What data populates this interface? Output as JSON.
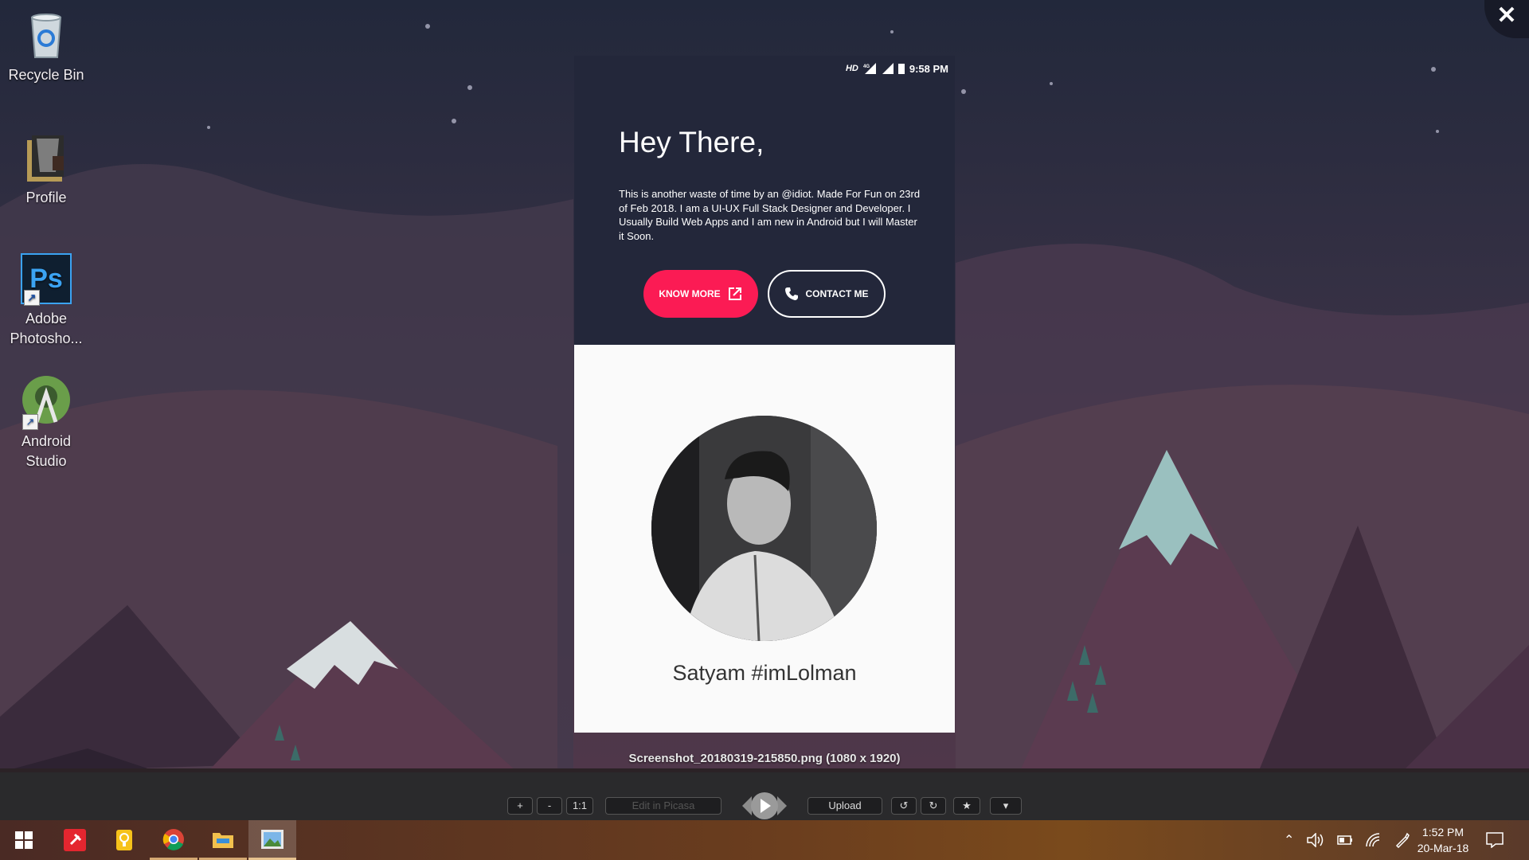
{
  "desktop": {
    "icons": [
      {
        "label": "Recycle Bin",
        "icon": "recycle-bin-icon"
      },
      {
        "label": "Profile",
        "icon": "folder-icon"
      },
      {
        "label": "Adobe\nPhotosho...",
        "icon_text": "Ps",
        "icon": "photoshop-icon"
      },
      {
        "label": "Android\nStudio",
        "icon": "android-studio-icon"
      }
    ]
  },
  "viewer": {
    "close_glyph": "✕",
    "filename": "Screenshot_20180319-215850.png (1080 x 1920)",
    "toolbar": {
      "zoom_in": "+",
      "zoom_out": "-",
      "actual_size": "1:1",
      "edit": "Edit in Picasa",
      "upload": "Upload",
      "rotate_left_glyph": "↺",
      "rotate_right_glyph": "↻",
      "star_glyph": "★",
      "more_glyph": "▾"
    }
  },
  "phone": {
    "status": {
      "hd": "HD",
      "network": "4G",
      "time": "9:58 PM"
    },
    "heading": "Hey There,",
    "bio": "This is another waste of time by an @idiot. Made For Fun on 23rd of Feb 2018. I am a UI-UX Full Stack Designer and Developer. I Usually Build Web Apps and I am new in Android but I will Master it Soon.",
    "know_more": "KNOW MORE",
    "contact_me": "CONTACT ME",
    "name": "Satyam #imLolman",
    "colors": {
      "header_bg": "#23273a",
      "accent": "#fb1b54",
      "body_bg": "#fafafa"
    }
  },
  "taskbar": {
    "apps": [
      "windows-start-icon",
      "sticky-pin-icon",
      "lightbulb-icon",
      "chrome-icon",
      "file-explorer-icon",
      "photo-viewer-icon"
    ],
    "tray": {
      "time": "1:52 PM",
      "date": "20-Mar-18"
    }
  }
}
